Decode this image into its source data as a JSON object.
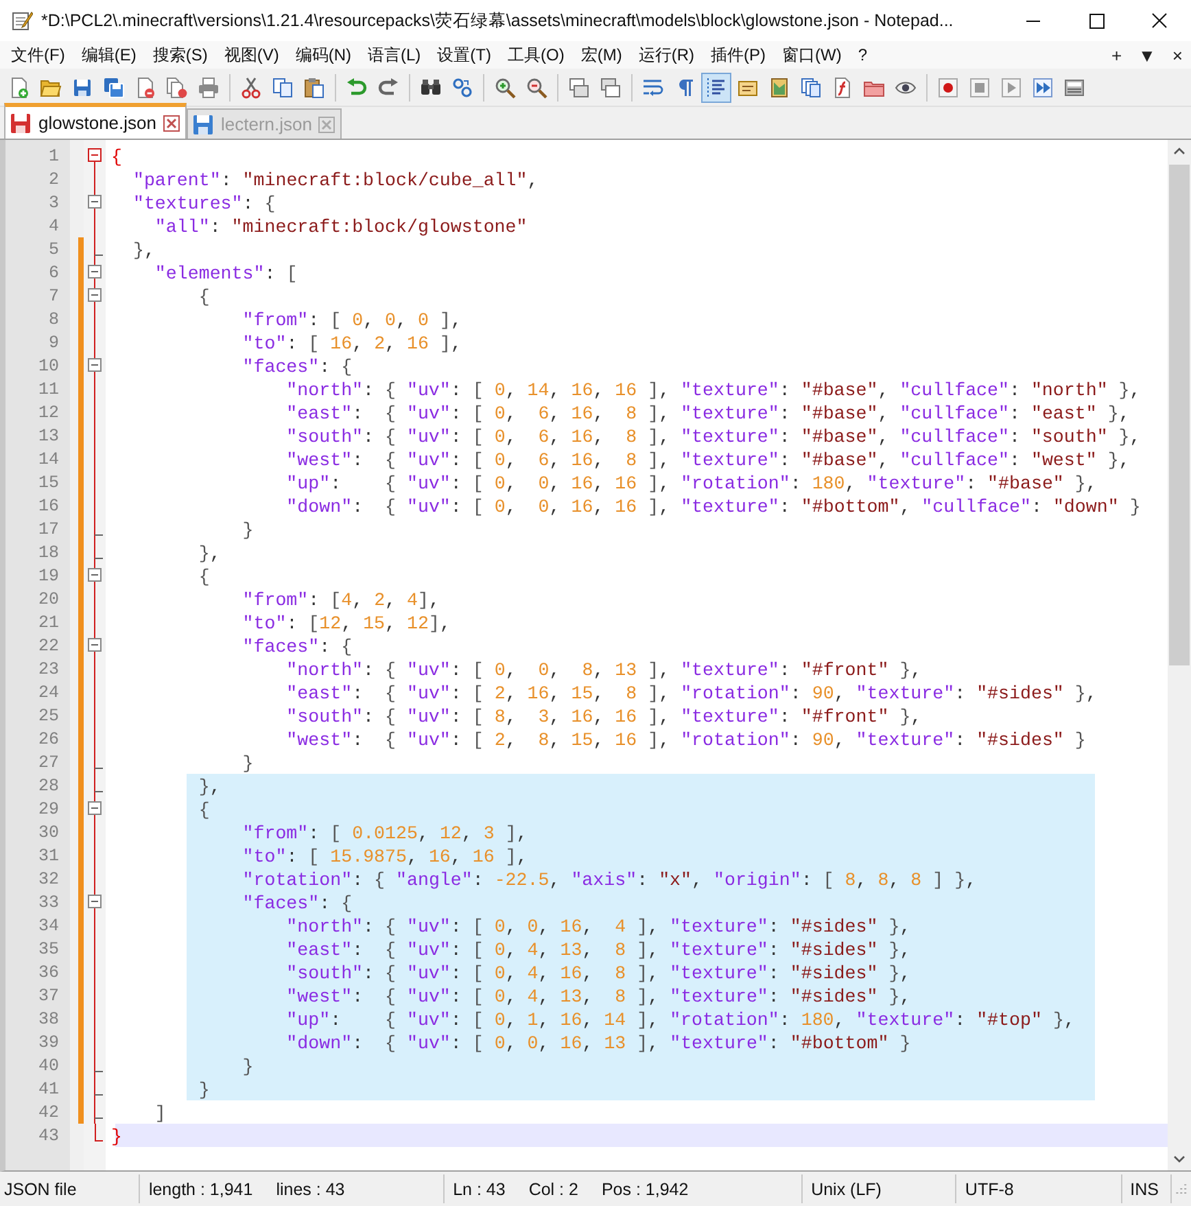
{
  "window": {
    "title": "*D:\\PCL2\\.minecraft\\versions\\1.21.4\\resourcepacks\\荧石绿幕\\assets\\minecraft\\models\\block\\glowstone.json - Notepad..."
  },
  "menu": [
    "文件(F)",
    "编辑(E)",
    "搜索(S)",
    "视图(V)",
    "编码(N)",
    "语言(L)",
    "设置(T)",
    "工具(O)",
    "宏(M)",
    "运行(R)",
    "插件(P)",
    "窗口(W)",
    "?"
  ],
  "menu_controls": [
    "+",
    "▼",
    "×"
  ],
  "toolbar": [
    {
      "kind": "new",
      "on": false
    },
    {
      "kind": "open",
      "on": false
    },
    {
      "kind": "save",
      "on": false
    },
    {
      "kind": "saveall",
      "on": false
    },
    {
      "kind": "close",
      "on": false
    },
    {
      "kind": "closeall",
      "on": false
    },
    {
      "kind": "print",
      "on": false
    },
    {
      "kind": "separator"
    },
    {
      "kind": "cut",
      "on": false
    },
    {
      "kind": "copy",
      "on": false
    },
    {
      "kind": "paste",
      "on": false
    },
    {
      "kind": "separator"
    },
    {
      "kind": "undo",
      "on": false
    },
    {
      "kind": "redo",
      "on": false
    },
    {
      "kind": "separator"
    },
    {
      "kind": "find",
      "on": false
    },
    {
      "kind": "replace",
      "on": false
    },
    {
      "kind": "separator"
    },
    {
      "kind": "zoomin",
      "on": false
    },
    {
      "kind": "zoomout",
      "on": false
    },
    {
      "kind": "separator"
    },
    {
      "kind": "syncv",
      "on": false
    },
    {
      "kind": "synch",
      "on": false
    },
    {
      "kind": "separator"
    },
    {
      "kind": "wrap",
      "on": false
    },
    {
      "kind": "pilcrow",
      "on": false
    },
    {
      "kind": "indent",
      "on": true
    },
    {
      "kind": "udl",
      "on": false
    },
    {
      "kind": "docmap",
      "on": false
    },
    {
      "kind": "doclist",
      "on": false
    },
    {
      "kind": "funclist",
      "on": false
    },
    {
      "kind": "folder",
      "on": false
    },
    {
      "kind": "monitor",
      "on": false
    },
    {
      "kind": "separator"
    },
    {
      "kind": "record",
      "on": false
    },
    {
      "kind": "stop",
      "on": false
    },
    {
      "kind": "play",
      "on": false
    },
    {
      "kind": "playmulti",
      "on": false
    },
    {
      "kind": "savemacro",
      "on": false
    }
  ],
  "tabs": [
    {
      "label": "glowstone.json",
      "selected": true,
      "modified": true
    },
    {
      "label": "lectern.json",
      "selected": false,
      "modified": false
    }
  ],
  "editor": {
    "lines": [
      {
        "number": "1",
        "text": "{",
        "kind": "open",
        "changed": false,
        "selected": false,
        "current": false,
        "brace_match": true
      },
      {
        "number": "2",
        "text": "  \"parent\": \"minecraft:block/cube_all\",",
        "kind": "plain",
        "changed": false,
        "selected": false,
        "current": false
      },
      {
        "number": "3",
        "text": "  \"textures\": {",
        "kind": "open",
        "changed": false,
        "selected": false,
        "current": false
      },
      {
        "number": "4",
        "text": "    \"all\": \"minecraft:block/glowstone\"",
        "kind": "plain",
        "changed": false,
        "selected": false,
        "current": false
      },
      {
        "number": "5",
        "text": "  },",
        "kind": "end",
        "changed": true,
        "selected": false,
        "current": false
      },
      {
        "number": "6",
        "text": "    \"elements\": [",
        "kind": "open",
        "changed": true,
        "selected": false,
        "current": false
      },
      {
        "number": "7",
        "text": "        {",
        "kind": "open",
        "changed": true,
        "selected": false,
        "current": false
      },
      {
        "number": "8",
        "text": "            \"from\": [ 0, 0, 0 ],",
        "kind": "plain",
        "changed": true,
        "selected": false,
        "current": false
      },
      {
        "number": "9",
        "text": "            \"to\": [ 16, 2, 16 ],",
        "kind": "plain",
        "changed": true,
        "selected": false,
        "current": false
      },
      {
        "number": "10",
        "text": "            \"faces\": {",
        "kind": "open",
        "changed": true,
        "selected": false,
        "current": false
      },
      {
        "number": "11",
        "text": "                \"north\": { \"uv\": [ 0, 14, 16, 16 ], \"texture\": \"#base\", \"cullface\": \"north\" },",
        "kind": "plain",
        "changed": true,
        "selected": false,
        "current": false
      },
      {
        "number": "12",
        "text": "                \"east\":  { \"uv\": [ 0,  6, 16,  8 ], \"texture\": \"#base\", \"cullface\": \"east\" },",
        "kind": "plain",
        "changed": true,
        "selected": false,
        "current": false
      },
      {
        "number": "13",
        "text": "                \"south\": { \"uv\": [ 0,  6, 16,  8 ], \"texture\": \"#base\", \"cullface\": \"south\" },",
        "kind": "plain",
        "changed": true,
        "selected": false,
        "current": false
      },
      {
        "number": "14",
        "text": "                \"west\":  { \"uv\": [ 0,  6, 16,  8 ], \"texture\": \"#base\", \"cullface\": \"west\" },",
        "kind": "plain",
        "changed": true,
        "selected": false,
        "current": false
      },
      {
        "number": "15",
        "text": "                \"up\":    { \"uv\": [ 0,  0, 16, 16 ], \"rotation\": 180, \"texture\": \"#base\" },",
        "kind": "plain",
        "changed": true,
        "selected": false,
        "current": false
      },
      {
        "number": "16",
        "text": "                \"down\":  { \"uv\": [ 0,  0, 16, 16 ], \"texture\": \"#bottom\", \"cullface\": \"down\" }",
        "kind": "plain",
        "changed": true,
        "selected": false,
        "current": false
      },
      {
        "number": "17",
        "text": "            }",
        "kind": "end",
        "changed": true,
        "selected": false,
        "current": false
      },
      {
        "number": "18",
        "text": "        },",
        "kind": "end",
        "changed": true,
        "selected": false,
        "current": false
      },
      {
        "number": "19",
        "text": "        {",
        "kind": "open",
        "changed": true,
        "selected": false,
        "current": false
      },
      {
        "number": "20",
        "text": "            \"from\": [4, 2, 4],",
        "kind": "plain",
        "changed": true,
        "selected": false,
        "current": false
      },
      {
        "number": "21",
        "text": "            \"to\": [12, 15, 12],",
        "kind": "plain",
        "changed": true,
        "selected": false,
        "current": false
      },
      {
        "number": "22",
        "text": "            \"faces\": {",
        "kind": "open",
        "changed": true,
        "selected": false,
        "current": false
      },
      {
        "number": "23",
        "text": "                \"north\": { \"uv\": [ 0,  0,  8, 13 ], \"texture\": \"#front\" },",
        "kind": "plain",
        "changed": true,
        "selected": false,
        "current": false
      },
      {
        "number": "24",
        "text": "                \"east\":  { \"uv\": [ 2, 16, 15,  8 ], \"rotation\": 90, \"texture\": \"#sides\" },",
        "kind": "plain",
        "changed": true,
        "selected": false,
        "current": false
      },
      {
        "number": "25",
        "text": "                \"south\": { \"uv\": [ 8,  3, 16, 16 ], \"texture\": \"#front\" },",
        "kind": "plain",
        "changed": true,
        "selected": false,
        "current": false
      },
      {
        "number": "26",
        "text": "                \"west\":  { \"uv\": [ 2,  8, 15, 16 ], \"rotation\": 90, \"texture\": \"#sides\" }",
        "kind": "plain",
        "changed": true,
        "selected": false,
        "current": false
      },
      {
        "number": "27",
        "text": "            }",
        "kind": "end",
        "changed": true,
        "selected": false,
        "current": false
      },
      {
        "number": "28",
        "text": "        },",
        "kind": "end",
        "changed": true,
        "selected": true,
        "current": false
      },
      {
        "number": "29",
        "text": "        {",
        "kind": "open",
        "changed": true,
        "selected": true,
        "current": false
      },
      {
        "number": "30",
        "text": "            \"from\": [ 0.0125, 12, 3 ],",
        "kind": "plain",
        "changed": true,
        "selected": true,
        "current": false
      },
      {
        "number": "31",
        "text": "            \"to\": [ 15.9875, 16, 16 ],",
        "kind": "plain",
        "changed": true,
        "selected": true,
        "current": false
      },
      {
        "number": "32",
        "text": "            \"rotation\": { \"angle\": -22.5, \"axis\": \"x\", \"origin\": [ 8, 8, 8 ] },",
        "kind": "plain",
        "changed": true,
        "selected": true,
        "current": false
      },
      {
        "number": "33",
        "text": "            \"faces\": {",
        "kind": "open",
        "changed": true,
        "selected": true,
        "current": false
      },
      {
        "number": "34",
        "text": "                \"north\": { \"uv\": [ 0, 0, 16,  4 ], \"texture\": \"#sides\" },",
        "kind": "plain",
        "changed": true,
        "selected": true,
        "current": false
      },
      {
        "number": "35",
        "text": "                \"east\":  { \"uv\": [ 0, 4, 13,  8 ], \"texture\": \"#sides\" },",
        "kind": "plain",
        "changed": true,
        "selected": true,
        "current": false
      },
      {
        "number": "36",
        "text": "                \"south\": { \"uv\": [ 0, 4, 16,  8 ], \"texture\": \"#sides\" },",
        "kind": "plain",
        "changed": true,
        "selected": true,
        "current": false
      },
      {
        "number": "37",
        "text": "                \"west\":  { \"uv\": [ 0, 4, 13,  8 ], \"texture\": \"#sides\" },",
        "kind": "plain",
        "changed": true,
        "selected": true,
        "current": false
      },
      {
        "number": "38",
        "text": "                \"up\":    { \"uv\": [ 0, 1, 16, 14 ], \"rotation\": 180, \"texture\": \"#top\" },",
        "kind": "plain",
        "changed": true,
        "selected": true,
        "current": false
      },
      {
        "number": "39",
        "text": "                \"down\":  { \"uv\": [ 0, 0, 16, 13 ], \"texture\": \"#bottom\" }",
        "kind": "plain",
        "changed": true,
        "selected": true,
        "current": false
      },
      {
        "number": "40",
        "text": "            }",
        "kind": "end",
        "changed": true,
        "selected": true,
        "current": false
      },
      {
        "number": "41",
        "text": "        }",
        "kind": "end",
        "changed": true,
        "selected": true,
        "current": false
      },
      {
        "number": "42",
        "text": "    ]",
        "kind": "end",
        "changed": true,
        "selected": false,
        "current": false
      },
      {
        "number": "43",
        "text": "}",
        "kind": "last",
        "changed": false,
        "selected": false,
        "current": true,
        "brace_match": true
      }
    ]
  },
  "status_bar": {
    "file_type": "JSON file",
    "length": "length : 1,941",
    "lines": "lines : 43",
    "ln": "Ln : 43",
    "col": "Col : 2",
    "pos": "Pos : 1,942",
    "eol": "Unix (LF)",
    "encoding": "UTF-8",
    "mode": "INS"
  }
}
